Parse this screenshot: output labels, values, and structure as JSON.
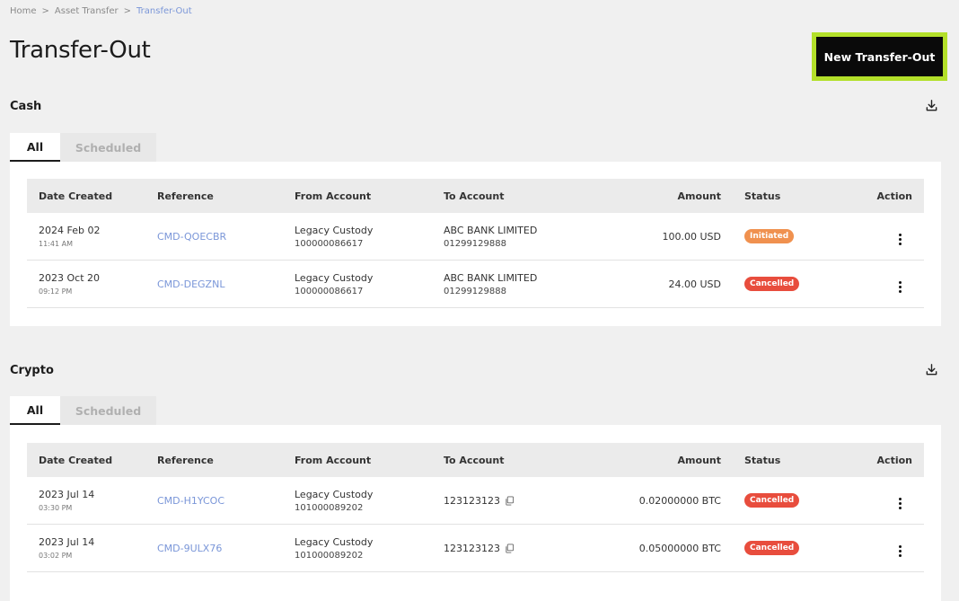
{
  "breadcrumb": {
    "home": "Home",
    "sep1": ">",
    "parent": "Asset Transfer",
    "sep2": ">",
    "current": "Transfer-Out"
  },
  "page": {
    "title": "Transfer-Out",
    "new_button": "New Transfer-Out"
  },
  "colors": {
    "accent_border": "#b3e02a",
    "link": "#7a96d8",
    "initiated": "#f0914f",
    "cancelled": "#e84d3d"
  },
  "cash": {
    "title": "Cash",
    "tabs": [
      {
        "label": "All"
      },
      {
        "label": "Scheduled"
      }
    ],
    "headers": {
      "date": "Date Created",
      "reference": "Reference",
      "from": "From Account",
      "to": "To Account",
      "amount": "Amount",
      "status": "Status",
      "action": "Action"
    },
    "rows": [
      {
        "date": "2024 Feb 02",
        "time": "11:41 AM",
        "reference": "CMD-QOECBR",
        "from_name": "Legacy Custody",
        "from_num": "100000086617",
        "to_name": "ABC BANK LIMITED",
        "to_num": "01299129888",
        "amount": "100.00 USD",
        "status": "Initiated"
      },
      {
        "date": "2023 Oct 20",
        "time": "09:12 PM",
        "reference": "CMD-DEGZNL",
        "from_name": "Legacy Custody",
        "from_num": "100000086617",
        "to_name": "ABC BANK LIMITED",
        "to_num": "01299129888",
        "amount": "24.00 USD",
        "status": "Cancelled"
      }
    ]
  },
  "crypto": {
    "title": "Crypto",
    "tabs": [
      {
        "label": "All"
      },
      {
        "label": "Scheduled"
      }
    ],
    "headers": {
      "date": "Date Created",
      "reference": "Reference",
      "from": "From Account",
      "to": "To Account",
      "amount": "Amount",
      "status": "Status",
      "action": "Action"
    },
    "rows": [
      {
        "date": "2023 Jul 14",
        "time": "03:30 PM",
        "reference": "CMD-H1YCOC",
        "from_name": "Legacy Custody",
        "from_num": "101000089202",
        "to_addr": "123123123",
        "amount": "0.02000000 BTC",
        "status": "Cancelled"
      },
      {
        "date": "2023 Jul 14",
        "time": "03:02 PM",
        "reference": "CMD-9ULX76",
        "from_name": "Legacy Custody",
        "from_num": "101000089202",
        "to_addr": "123123123",
        "amount": "0.05000000 BTC",
        "status": "Cancelled"
      }
    ]
  }
}
